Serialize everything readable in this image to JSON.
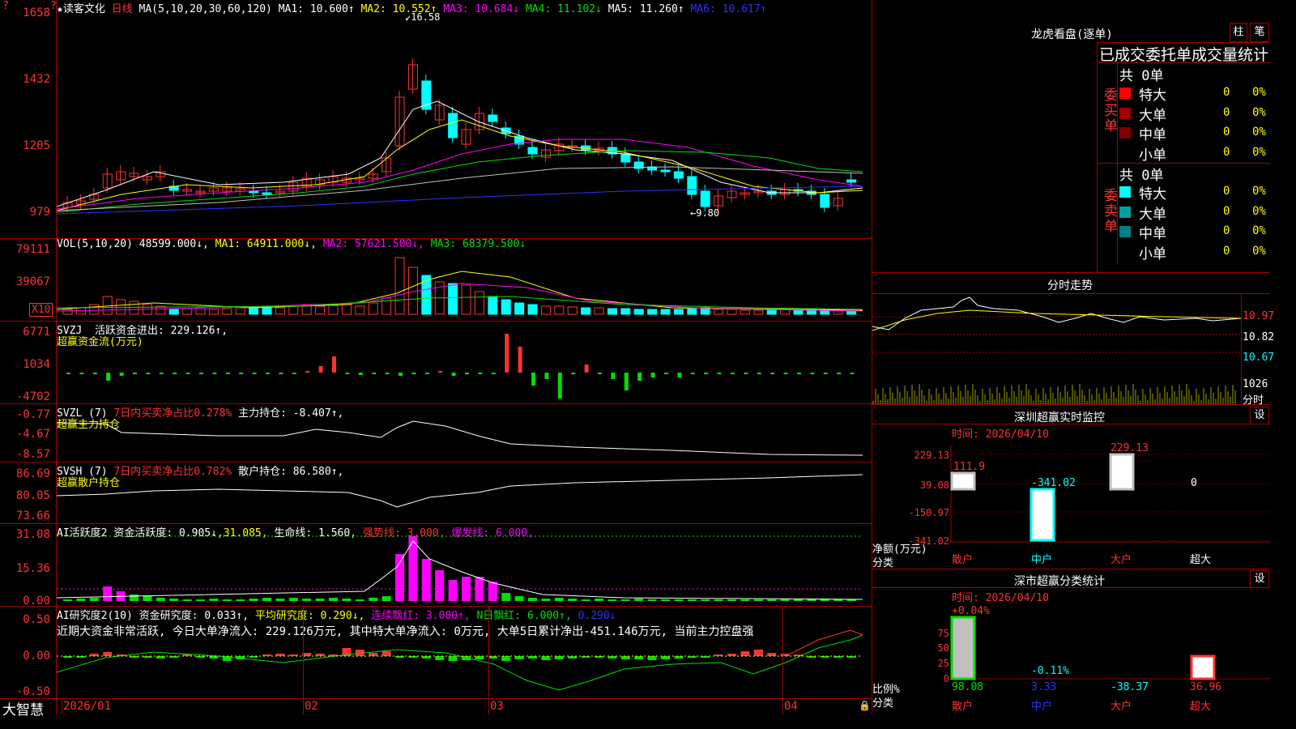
{
  "app": {
    "brand": "大智慧",
    "star": "★",
    "stock_name": "读客文化",
    "period": "日线",
    "corner_mark": "?",
    "corner_mark2": "?"
  },
  "price_panel": {
    "ma_params": "MA(5,10,20,30,60,120)",
    "ma1": "MA1: 10.600↑",
    "ma2": "MA2: 10.552↑",
    "ma3": "MA3: 10.684↓",
    "ma4": "MA4: 11.102↓",
    "ma5": "MA5: 11.260↑",
    "ma6": "MA6: 10.617↑",
    "high_mark": "16.58",
    "low_mark": "9.80",
    "y_labels": [
      "1658",
      "1432",
      "1205",
      "979"
    ]
  },
  "vol_panel": {
    "title": "VOL(5,10,20)",
    "value": "48599.000↓,",
    "ma1": "MA1: 64911.000↓,",
    "ma2": "MA2: 57621.500↓,",
    "ma3": "MA3: 68379.500↓",
    "y_labels": [
      "79111",
      "39067"
    ],
    "unit": "X10"
  },
  "svzj_panel": {
    "title": "SVZJ",
    "label": "活跃资金进出: 229.126↑,",
    "sub": "超赢资金流(万元)",
    "y_labels": [
      "6771",
      "1034",
      "-4702"
    ]
  },
  "svzl_panel": {
    "title": "SVZL (7)",
    "pct": "7日内买卖净占比0.278%",
    "label": "主力持仓: -8.407↑,",
    "sub": "超赢主力持仓",
    "y_labels": [
      "-0.77",
      "-4.67",
      "-8.57"
    ]
  },
  "svsh_panel": {
    "title": "SVSH (7)",
    "pct": "7日内买卖净占比0.782%",
    "label": "散户持仓: 86.580↑,",
    "sub": "超赢散户持仓",
    "y_labels": [
      "86.69",
      "80.05",
      "73.66"
    ]
  },
  "ai_active_panel": {
    "title": "AI活跃度2",
    "label": "资金活跃度: 0.905↓,",
    "v2": "31.085,",
    "life": "生命线: 1.560,",
    "strong": "强势线: 3.000,",
    "burst": "爆发线: 6.000,",
    "y_labels": [
      "31.08",
      "15.36",
      "0.00"
    ]
  },
  "ai_research_panel": {
    "title": "AI研究度2(10)",
    "label": "资金研究度: 0.033↑,",
    "avg": "平均研究度: 0.290↓,",
    "cont": "连续飘红: 3.000↑,",
    "nday": "N日飘红: 6.000↑,",
    "last": "0.290↓",
    "y_labels": [
      "0.50",
      "0.00",
      "-0.50"
    ],
    "comment": "近期大资金非常活跃, 今日大单净流入: 229.126万元, 其中特大单净流入: 0万元, 大单5日累计净出-451.146万元, 当前主力控盘强"
  },
  "x_axis": [
    "2026/01",
    "02",
    "03",
    "04"
  ],
  "right": {
    "dragon_title": "龙虎看盘(逐单)",
    "btn_bar": "柱",
    "btn_line": "笔",
    "tabs_text": "已成交委托单成交量统计",
    "buy_label": "委买单",
    "sell_label": "委卖单",
    "buy_total": "共 0单",
    "sell_total": "共 0单",
    "buy_rows": [
      {
        "name": "特大",
        "v": "0",
        "p": "0%",
        "c": "#ff0000"
      },
      {
        "name": "大单",
        "v": "0",
        "p": "0%",
        "c": "#a00000"
      },
      {
        "name": "中单",
        "v": "0",
        "p": "0%",
        "c": "#800000"
      },
      {
        "name": "小单",
        "v": "0",
        "p": "0%",
        "c": "#000000"
      }
    ],
    "sell_rows": [
      {
        "name": "特大",
        "v": "0",
        "p": "0%",
        "c": "#00ffff"
      },
      {
        "name": "大单",
        "v": "0",
        "p": "0%",
        "c": "#00a0a0"
      },
      {
        "name": "中单",
        "v": "0",
        "p": "0%",
        "c": "#008080"
      },
      {
        "name": "小单",
        "v": "0",
        "p": "0%",
        "c": "#000000"
      }
    ],
    "intraday_title": "分时走势",
    "intraday_y": [
      "10.97",
      "10.82",
      "10.67"
    ],
    "intraday_vol": "1026",
    "intraday_unit": "分时",
    "sz_monitor_title": "深圳超赢实时监控",
    "set": "设",
    "sz_time": "时间: 2026/04/10",
    "sz_y": [
      "229.13",
      "39.08",
      "-150.97",
      "-341.02"
    ],
    "sz_vals": [
      "111.9",
      "-341.02",
      "229.13",
      "0"
    ],
    "sz_ylabel": "净额(万元)",
    "sz_xlabel": "分类",
    "cats": [
      "散户",
      "中户",
      "大户",
      "超大"
    ],
    "sz_stat_title": "深市超赢分类统计",
    "st_time": "时间: 2026/04/10",
    "st_top": [
      "+0.04%",
      "-0.11%"
    ],
    "st_y": [
      "75",
      "50",
      "25",
      "0"
    ],
    "st_vals": [
      "98.08",
      "3.33",
      "-38.37",
      "36.96"
    ],
    "st_ylabel": "比例%",
    "st_xlabel": "分类"
  },
  "colors": {
    "up": "#ff3232",
    "down": "#00ffff",
    "border": "#a00000"
  }
}
